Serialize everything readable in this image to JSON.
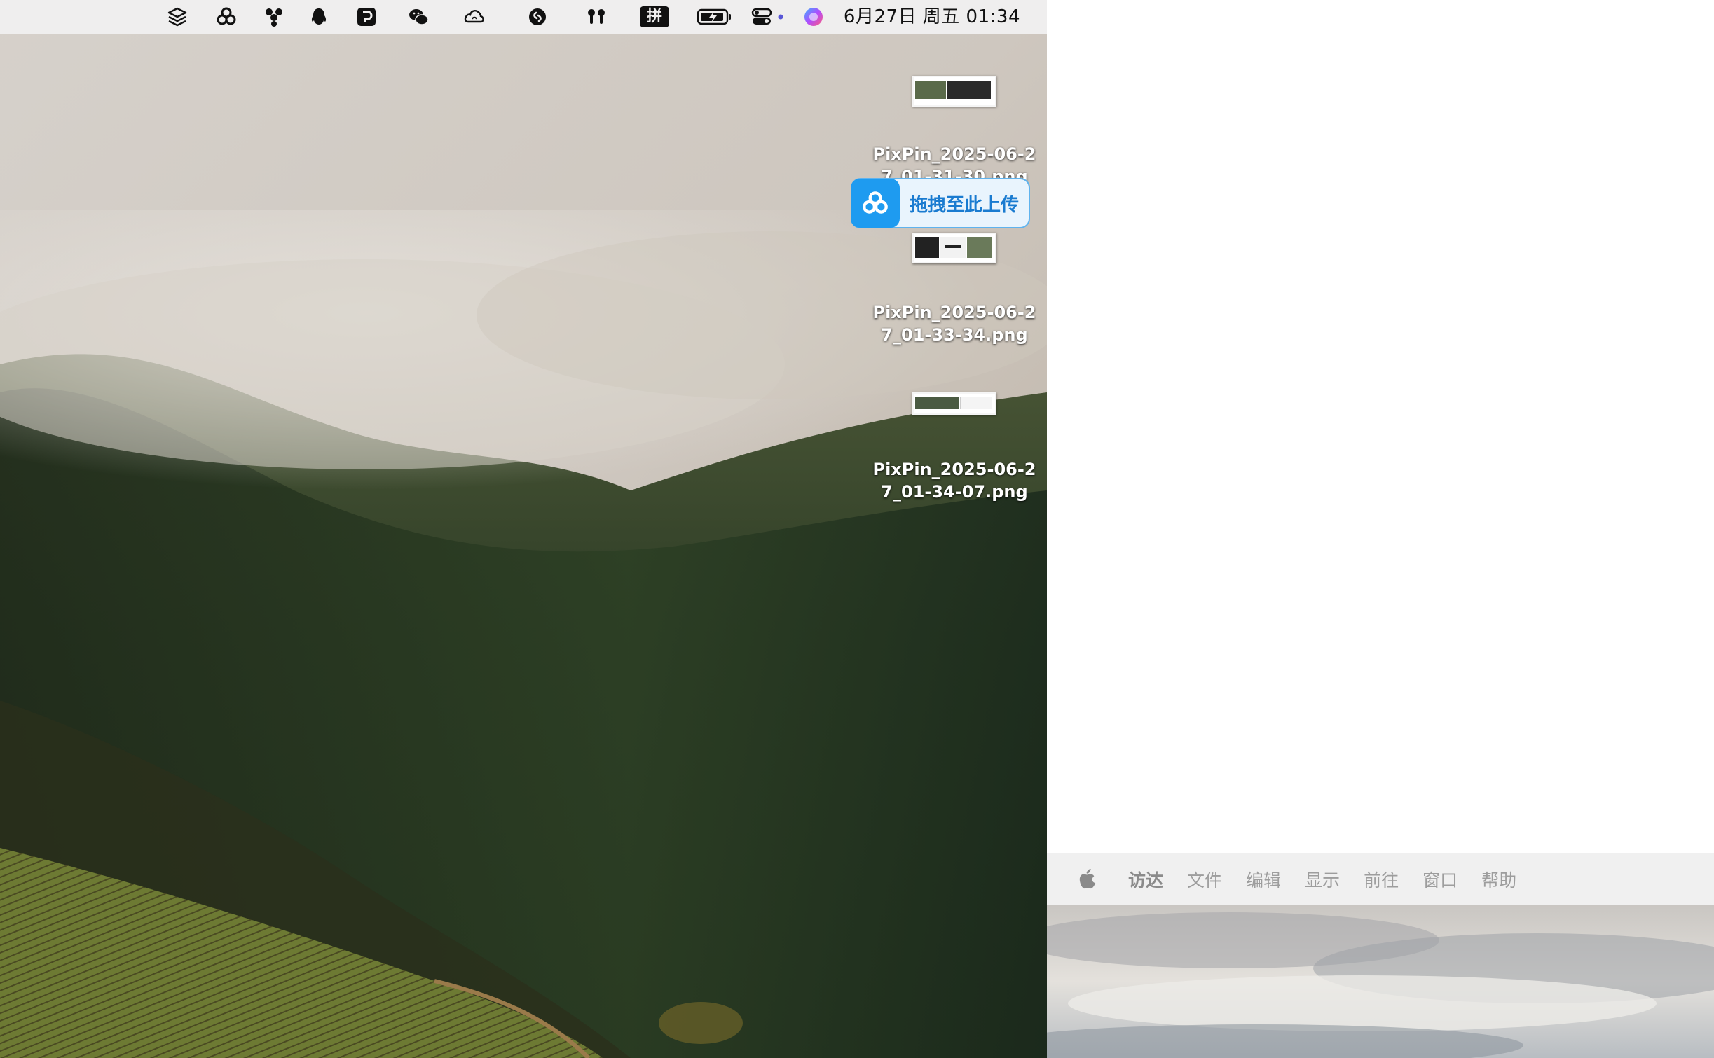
{
  "menubar": {
    "datetime": "6月27日 周五  01:34",
    "status_icons": [
      "layers-icon",
      "baidu-netdisk-icon",
      "tencent-icon",
      "qq-icon",
      "pixpin-icon",
      "wechat-icon",
      "creative-cloud-icon",
      "shazam-icon",
      "airpods-icon",
      "input-method-icon",
      "battery-icon",
      "control-center-icon",
      "siri-icon"
    ],
    "input_method_label": "拼"
  },
  "desktop": {
    "files": [
      {
        "name": "PixPin_2025-06-2\n7_01-31-30.png"
      },
      {
        "name": "PixPin_2025-06-2\n7_01-33-34.png"
      },
      {
        "name": "PixPin_2025-06-2\n7_01-34-07.png"
      }
    ],
    "upload_bubble": {
      "label": "拖拽至此上传"
    }
  },
  "secondary_menubar": {
    "items": [
      "访达",
      "文件",
      "编辑",
      "显示",
      "前往",
      "窗口",
      "帮助"
    ]
  }
}
